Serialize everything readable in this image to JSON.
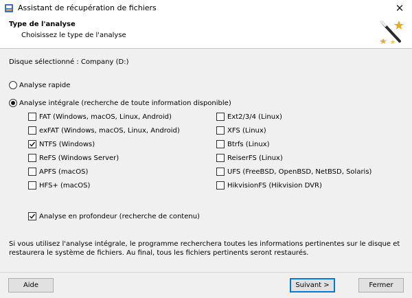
{
  "window": {
    "title": "Assistant de récupération de fichiers",
    "close_glyph": "✕"
  },
  "header": {
    "title": "Type de l'analyse",
    "subtitle": "Choisissez le type de l'analyse"
  },
  "disk": {
    "label": "Disque sélectionné : Company (D:)"
  },
  "scan_modes": [
    {
      "label": "Analyse rapide",
      "selected": false
    },
    {
      "label": "Analyse intégrale (recherche de toute information disponible)",
      "selected": true
    }
  ],
  "filesystems": {
    "left": [
      {
        "label": "FAT (Windows, macOS, Linux, Android)",
        "checked": false
      },
      {
        "label": "exFAT (Windows, macOS, Linux, Android)",
        "checked": false
      },
      {
        "label": "NTFS (Windows)",
        "checked": true
      },
      {
        "label": "ReFS (Windows Server)",
        "checked": false
      },
      {
        "label": "APFS (macOS)",
        "checked": false
      },
      {
        "label": "HFS+ (macOS)",
        "checked": false
      }
    ],
    "right": [
      {
        "label": "Ext2/3/4 (Linux)",
        "checked": false
      },
      {
        "label": "XFS (Linux)",
        "checked": false
      },
      {
        "label": "Btrfs (Linux)",
        "checked": false
      },
      {
        "label": "ReiserFS (Linux)",
        "checked": false
      },
      {
        "label": "UFS (FreeBSD, OpenBSD, NetBSD, Solaris)",
        "checked": false
      },
      {
        "label": "HikvisionFS (Hikvision DVR)",
        "checked": false
      }
    ]
  },
  "deep_scan": {
    "label": "Analyse en profondeur (recherche de contenu)",
    "checked": true
  },
  "info_text": "Si vous utilisez l'analyse intégrale, le programme recherchera toutes les informations pertinentes sur le disque et restaurera le système de fichiers. Au final, tous les fichiers pertinents seront restaurés.",
  "footer": {
    "help_label": "Aide",
    "next_label": "Suivant >",
    "close_label": "Fermer"
  },
  "icons": {
    "app": "app-icon",
    "wizard": "magic-wand-icon",
    "check": "check-icon"
  },
  "colors": {
    "primary_button_border": "#0078d7",
    "background": "#f0f0f0"
  }
}
